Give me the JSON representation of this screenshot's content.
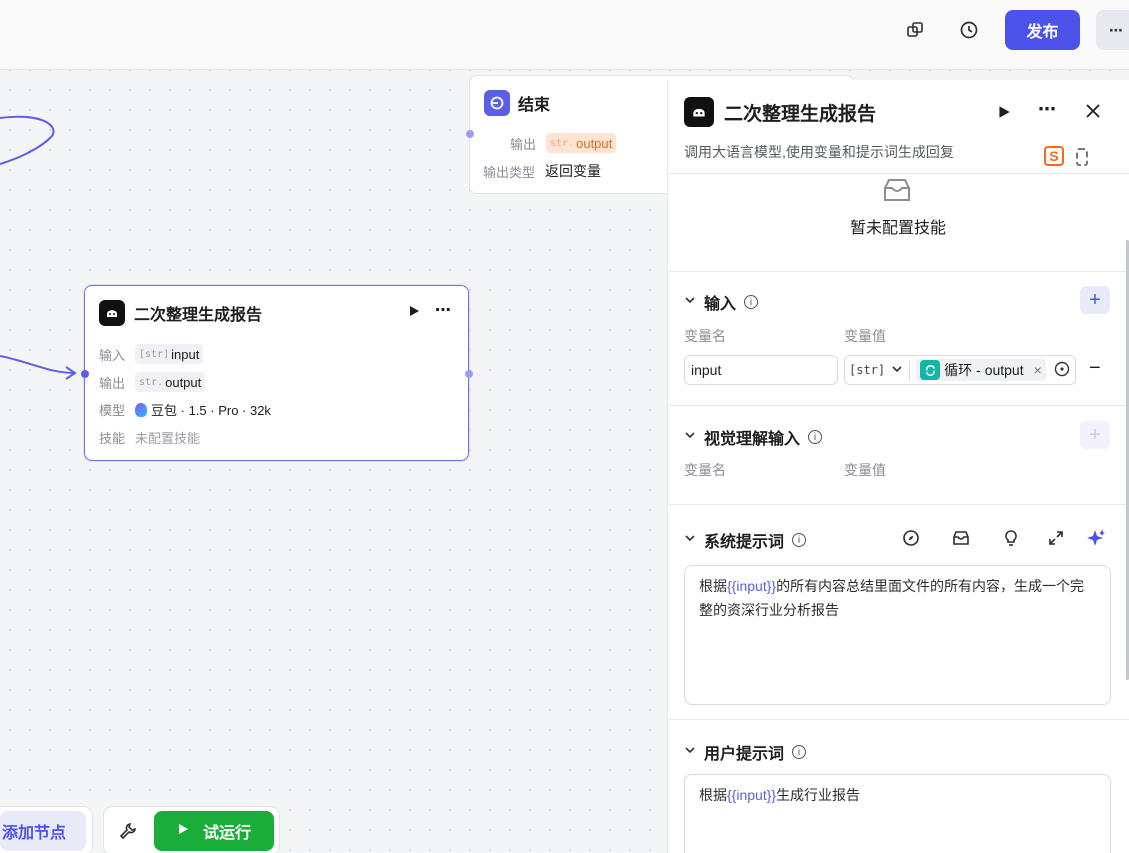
{
  "topbar": {
    "publish_label": "发布",
    "more_label": "⋯"
  },
  "end_node": {
    "title": "结束",
    "output_label": "输出",
    "output_type_prefix": "str.",
    "output_value": "output",
    "output_type_label": "输出类型",
    "output_type_value": "返回变量"
  },
  "llm_node": {
    "title": "二次整理生成报告",
    "input_label": "输入",
    "input_type_prefix": "[str]",
    "input_value": "input",
    "output_label": "输出",
    "output_type_prefix": "str.",
    "output_value": "output",
    "model_label": "模型",
    "model_value": "豆包 · 1.5 · Pro · 32k",
    "skill_label": "技能",
    "skill_value": "未配置技能"
  },
  "panel": {
    "title": "二次整理生成报告",
    "description": "调用大语言模型,使用变量和提示词生成回复",
    "no_skill_text": "暂未配置技能",
    "input_section": {
      "title": "输入",
      "col_name": "变量名",
      "col_value": "变量值",
      "var_name": "input",
      "var_type": "[str]",
      "ref_source": "循环 -",
      "ref_var": "output"
    },
    "vision_section": {
      "title": "视觉理解输入",
      "col_name": "变量名",
      "col_value": "变量值"
    },
    "system_prompt": {
      "title": "系统提示词",
      "text_before": "根据",
      "var": "{{input}}",
      "text_after": "的所有内容总结里面文件的所有内容，生成一个完整的资深行业分析报告"
    },
    "user_prompt": {
      "title": "用户提示词",
      "text_before": "根据",
      "var": "{{input}}",
      "text_after": "生成行业报告"
    }
  },
  "bottom": {
    "add_node_label": "添加节点",
    "run_label": "试运行"
  },
  "colors": {
    "accent": "#4d53e8",
    "run_green": "#1aad3a",
    "orange_tag": "#e36b1d"
  }
}
